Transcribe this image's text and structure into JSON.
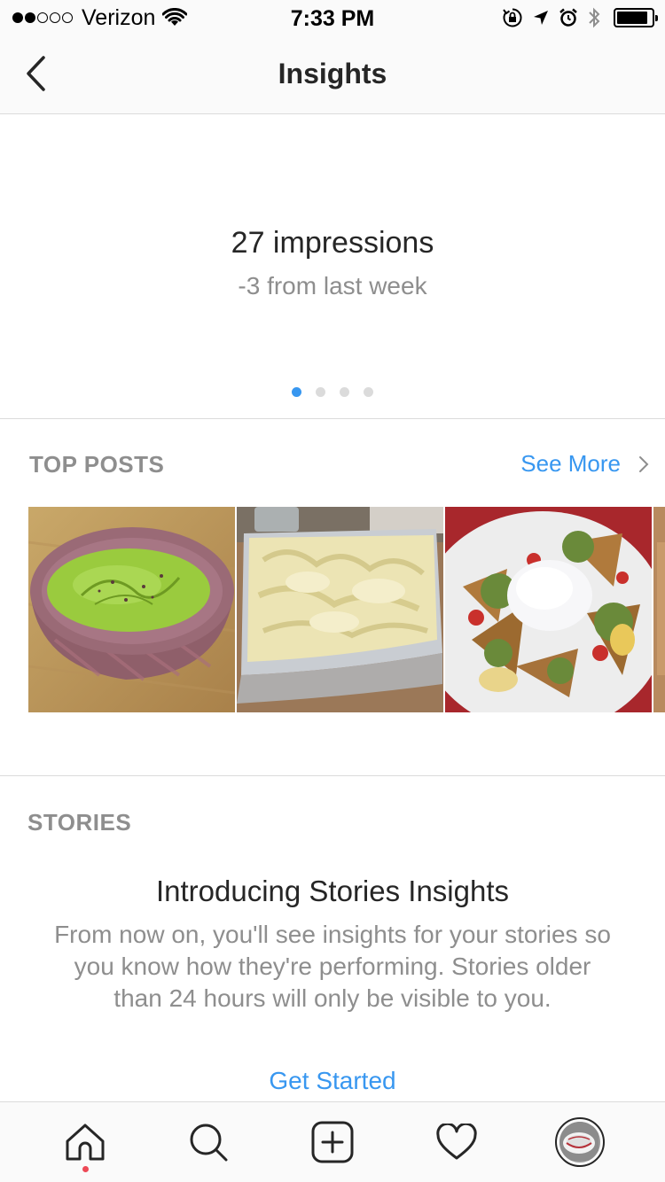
{
  "status_bar": {
    "carrier": "Verizon",
    "time": "7:33 PM",
    "signal_bars_filled": 2,
    "signal_bars_total": 5,
    "battery_level": 0.9
  },
  "nav": {
    "title": "Insights",
    "back_icon": "chevron-left-icon"
  },
  "impressions": {
    "headline": "27 impressions",
    "change": "-3 from last week",
    "page_count": 4,
    "active_page": 1
  },
  "top_posts": {
    "title": "TOP POSTS",
    "see_more": "See More",
    "posts": [
      {
        "subject": "green soup in bowl"
      },
      {
        "subject": "ice cream in container"
      },
      {
        "subject": "loaded potato wedges"
      }
    ]
  },
  "stories": {
    "title": "STORIES",
    "heading": "Introducing Stories Insights",
    "body": "From now on, you'll see insights for your stories so you know how they're performing. Stories older than 24 hours will only be visible to you.",
    "cta": "Get Started"
  },
  "tab_bar": {
    "items": [
      {
        "icon": "home-icon",
        "has_notification": true
      },
      {
        "icon": "search-icon",
        "has_notification": false
      },
      {
        "icon": "add-post-icon",
        "has_notification": false
      },
      {
        "icon": "heart-icon",
        "has_notification": false
      },
      {
        "icon": "profile-avatar",
        "has_notification": false
      }
    ]
  },
  "colors": {
    "accent": "#3897f0",
    "text_primary": "#262626",
    "text_secondary": "#8e8e8e",
    "divider": "#dbdbdb",
    "notification": "#ed4956"
  }
}
